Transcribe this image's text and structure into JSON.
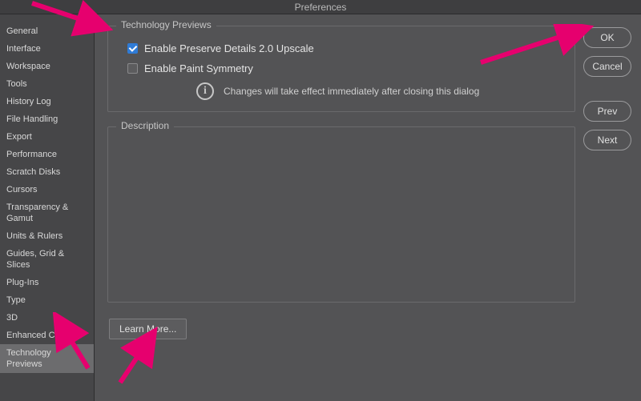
{
  "window": {
    "title": "Preferences"
  },
  "sidebar": {
    "items": [
      {
        "label": "General"
      },
      {
        "label": "Interface"
      },
      {
        "label": "Workspace"
      },
      {
        "label": "Tools"
      },
      {
        "label": "History Log"
      },
      {
        "label": "File Handling"
      },
      {
        "label": "Export"
      },
      {
        "label": "Performance"
      },
      {
        "label": "Scratch Disks"
      },
      {
        "label": "Cursors"
      },
      {
        "label": "Transparency & Gamut"
      },
      {
        "label": "Units & Rulers"
      },
      {
        "label": "Guides, Grid & Slices"
      },
      {
        "label": "Plug-Ins"
      },
      {
        "label": "Type"
      },
      {
        "label": "3D"
      },
      {
        "label": "Enhanced Controls"
      },
      {
        "label": "Technology Previews"
      }
    ],
    "selected_index": 17
  },
  "panel": {
    "group_title": "Technology Previews",
    "options": [
      {
        "label": "Enable Preserve Details 2.0 Upscale",
        "checked": true
      },
      {
        "label": "Enable Paint Symmetry",
        "checked": false
      }
    ],
    "info_text": "Changes will take effect immediately after closing this dialog",
    "description_title": "Description",
    "learn_more_label": "Learn More..."
  },
  "buttons": {
    "ok": "OK",
    "cancel": "Cancel",
    "prev": "Prev",
    "next": "Next"
  },
  "annotation": {
    "color": "#E6006E"
  }
}
